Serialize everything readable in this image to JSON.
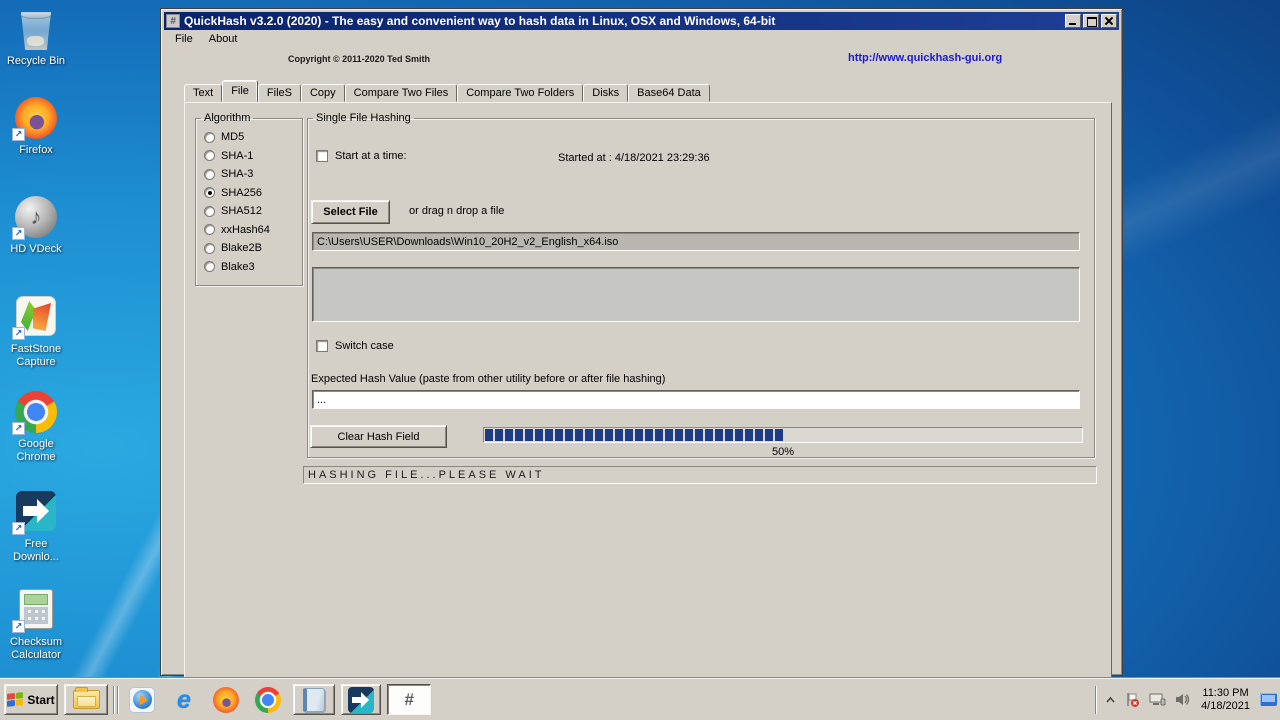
{
  "colors": {
    "titlebar": "#0a246a",
    "window_face": "#d4d0c8",
    "desktop_light": "#2aa9e1",
    "desktop_dark": "#0c3a74",
    "link": "#1a1ac8",
    "progress": "#1d3a85"
  },
  "desktop": {
    "icons": [
      {
        "icon": "recycle-bin-icon",
        "label": "Recycle Bin"
      },
      {
        "icon": "firefox-icon",
        "label": "Firefox"
      },
      {
        "icon": "hd-vdeck-icon",
        "label": "HD VDeck"
      },
      {
        "icon": "faststone-capture-icon",
        "label": "FastStone Capture"
      },
      {
        "icon": "google-chrome-icon",
        "label": "Google Chrome"
      },
      {
        "icon": "free-download-manager-icon",
        "label": "Free Downlo..."
      },
      {
        "icon": "checksum-calculator-icon",
        "label": "Checksum Calculator"
      }
    ]
  },
  "window": {
    "icon_glyph": "#",
    "title": "QuickHash v3.2.0 (2020) - The easy and convenient way to hash data in Linux, OSX and Windows, 64-bit",
    "menu": {
      "file": "File",
      "about": "About"
    },
    "copyright": "Copyright © 2011-2020  Ted Smith",
    "link": "http://www.quickhash-gui.org",
    "tabs": [
      {
        "label": "Text"
      },
      {
        "label": "File"
      },
      {
        "label": "FileS"
      },
      {
        "label": "Copy"
      },
      {
        "label": "Compare Two Files"
      },
      {
        "label": "Compare Two Folders"
      },
      {
        "label": "Disks"
      },
      {
        "label": "Base64 Data"
      }
    ],
    "active_tab": "File",
    "algorithm": {
      "legend": "Algorithm",
      "options": [
        "MD5",
        "SHA-1",
        "SHA-3",
        "SHA256",
        "SHA512",
        "xxHash64",
        "Blake2B",
        "Blake3"
      ],
      "selected": "SHA256"
    },
    "single_file": {
      "legend": "Single File Hashing",
      "start_at_label": "Start at a time:",
      "started_at": "Started at : 4/18/2021 23:29:36",
      "select_file_button": "Select File",
      "drag_hint": "or drag n drop a file",
      "file_path": "C:\\Users\\USER\\Downloads\\Win10_20H2_v2_English_x64.iso",
      "switch_case_label": "Switch case",
      "expected_hash_label": "Expected Hash Value (paste from other utility before or after file hashing)",
      "expected_hash_value": "...",
      "clear_button": "Clear Hash Field",
      "progress_percent": 50,
      "progress_text": "50%"
    },
    "status": "HASHING FILE...PLEASE WAIT"
  },
  "taskbar": {
    "start_label": "Start",
    "quickhash_glyph": "#",
    "tray": {
      "time": "11:30 PM",
      "date": "4/18/2021"
    }
  }
}
